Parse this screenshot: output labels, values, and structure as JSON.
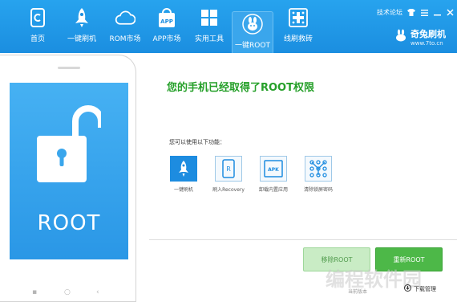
{
  "nav": {
    "items": [
      {
        "label": "首页",
        "icon": "home-icon"
      },
      {
        "label": "一键刷机",
        "icon": "rocket-icon"
      },
      {
        "label": "ROM市场",
        "icon": "cloud-icon"
      },
      {
        "label": "APP市场",
        "icon": "app-bag-icon"
      },
      {
        "label": "实用工具",
        "icon": "windows-grid-icon"
      },
      {
        "label": "一键ROOT",
        "icon": "rabbit-icon",
        "active": true
      },
      {
        "label": "线刷救砖",
        "icon": "rescue-grid-icon"
      }
    ]
  },
  "window": {
    "forum_link": "技术论坛",
    "brand_name": "奇兔刷机",
    "brand_url": "www.7to.cn"
  },
  "main": {
    "title": "您的手机已经取得了ROOT权限",
    "subtitle": "您可以使用以下功能：",
    "features": [
      {
        "label": "一键刷机",
        "icon": "rocket-icon"
      },
      {
        "label": "刷入Recovery",
        "icon": "phone-recovery-icon"
      },
      {
        "label": "卸载内置应用",
        "icon": "apk-icon"
      },
      {
        "label": "清除锁屏密码",
        "icon": "pattern-lock-icon"
      }
    ],
    "buttons": {
      "left": "移除ROOT",
      "right": "重新ROOT"
    }
  },
  "footer": {
    "left_text": "当前版本",
    "right_text": "下载管理"
  },
  "watermark": "编程软件园",
  "phone": {
    "screen_text": "ROOT"
  },
  "colors": {
    "nav_blue": "#1b8ee0",
    "title_green": "#26a02a",
    "button_green": "#4db848"
  }
}
